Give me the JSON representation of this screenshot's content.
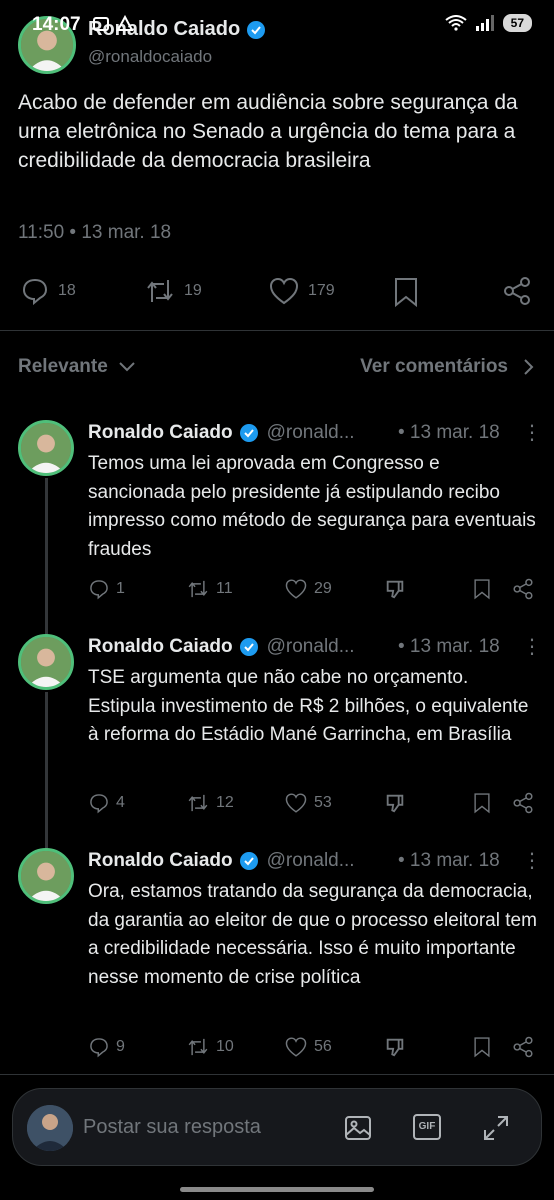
{
  "status": {
    "time": "14:07",
    "battery": "57"
  },
  "tweet": {
    "author": "Ronaldo Caiado",
    "handle": "@ronaldocaiado",
    "text": "Acabo de defender em audiência sobre segurança da urna eletrônica no Senado a urgência do tema para a credibilidade da democracia brasileira",
    "time": "11:50 • 13 mar. 18",
    "replies": "18",
    "retweets": "19",
    "likes": "179"
  },
  "sort": {
    "left_label": "Relevante",
    "right_label": "Ver comentários"
  },
  "replies": [
    {
      "author": "Ronaldo Caiado",
      "handle": "@ronald...",
      "date": "• 13 mar. 18",
      "text": "Temos uma lei aprovada em Congresso e sancionada pelo presidente já estipulando recibo impresso como método de segurança para eventuais fraudes",
      "replies": "1",
      "retweets": "11",
      "likes": "29"
    },
    {
      "author": "Ronaldo Caiado",
      "handle": "@ronald...",
      "date": "• 13 mar. 18",
      "text": "TSE argumenta que não cabe no orçamento. Estipula investimento de R$ 2 bilhões, o equivalente à reforma do Estádio Mané Garrincha, em Brasília",
      "replies": "4",
      "retweets": "12",
      "likes": "53"
    },
    {
      "author": "Ronaldo Caiado",
      "handle": "@ronald...",
      "date": "• 13 mar. 18",
      "text": "Ora, estamos tratando da segurança da democracia, da garantia ao eleitor de que o processo eleitoral tem a credibilidade necessária. Isso é muito importante nesse momento de crise política",
      "replies": "9",
      "retweets": "10",
      "likes": "56"
    }
  ],
  "reply_bar": {
    "placeholder": "Postar sua resposta",
    "gif_label": "GIF"
  },
  "colors": {
    "background": "#000000",
    "text": "#e7e9ea",
    "muted": "#71767b",
    "verified": "#1d9bf0",
    "avatar_ring": "#4fbf7a"
  }
}
